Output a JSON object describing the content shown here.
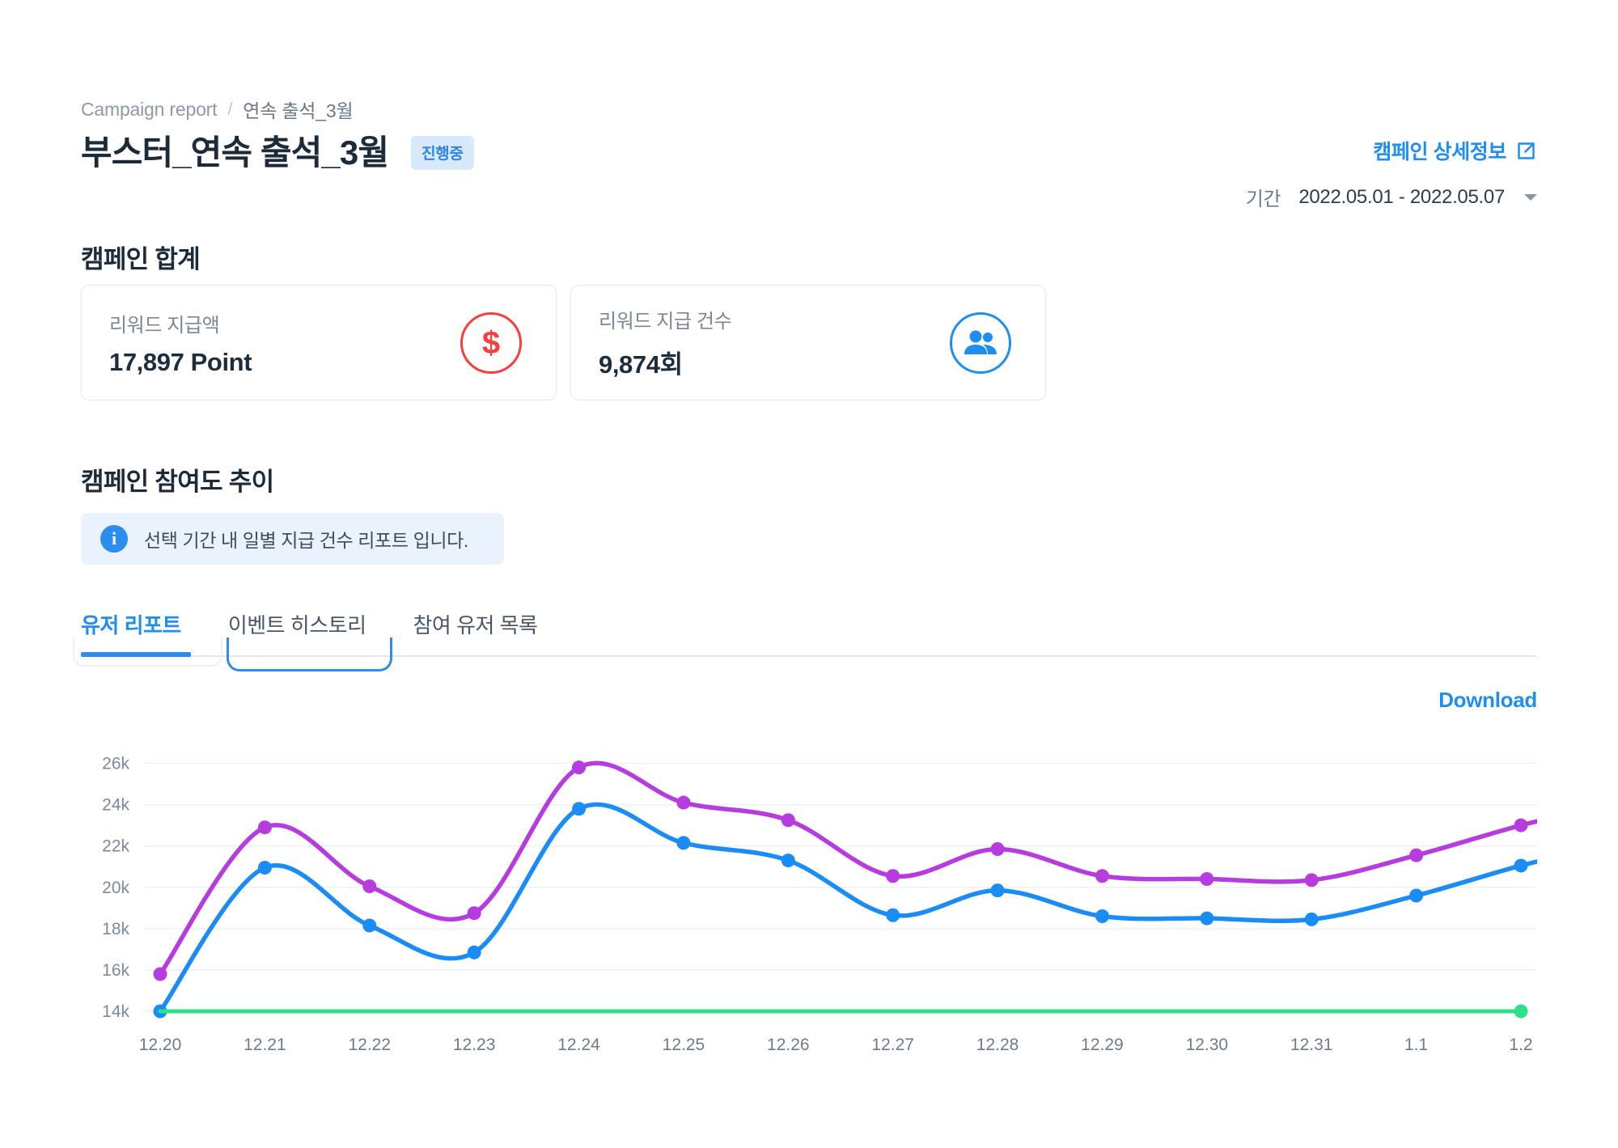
{
  "breadcrumb": {
    "root": "Campaign report",
    "separator": "/",
    "current": "연속 출석_3월"
  },
  "header": {
    "title": "부스터_연속 출석_3월",
    "status_badge": "진행중",
    "detail_link": "캠페인 상세정보",
    "detail_icon": "external-link-icon",
    "period_label": "기간",
    "period_value": "2022.05.01 - 2022.05.07",
    "period_caret": "chevron-down-icon"
  },
  "summary": {
    "title": "캠페인 합계",
    "cards": [
      {
        "label": "리워드 지급액",
        "value": "17,897 Point",
        "icon": "dollar-circle-icon",
        "icon_glyph": "$",
        "color": "#fa3e3e"
      },
      {
        "label": "리워드 지급 건수",
        "value": "9,874회",
        "icon": "users-circle-icon",
        "color": "#1f8ef1"
      }
    ]
  },
  "trend": {
    "title": "캠페인 참여도 추이",
    "info_icon": "info-icon",
    "info_glyph": "i",
    "info_text": "선택 기간 내 일별 지급 건수 리포트 입니다.",
    "tabs": [
      {
        "label": "유저 리포트",
        "active": true
      },
      {
        "label": "이벤트 히스토리",
        "active": false
      },
      {
        "label": "참여 유저 목록",
        "active": false
      }
    ],
    "download_label": "Download"
  },
  "chart_data": {
    "type": "line",
    "title": "",
    "xlabel": "",
    "ylabel": "",
    "grid": true,
    "legend": "none",
    "ylim": [
      14000,
      27000
    ],
    "yticks": [
      14000,
      16000,
      18000,
      20000,
      22000,
      24000,
      26000
    ],
    "ytick_labels": [
      "14k",
      "16k",
      "18k",
      "20k",
      "22k",
      "24k",
      "26k"
    ],
    "categories": [
      "12.20",
      "12.21",
      "12.22",
      "12.23",
      "12.24",
      "12.25",
      "12.26",
      "12.27",
      "12.28",
      "12.29",
      "12.30",
      "12.31",
      "1.1",
      "1.2"
    ],
    "series": [
      {
        "name": "purple-series",
        "color": "#b63ce0",
        "values": [
          15800,
          22900,
          20050,
          18750,
          25800,
          24100,
          23250,
          20550,
          21850,
          20550,
          20400,
          20350,
          21550,
          23000
        ]
      },
      {
        "name": "blue-series",
        "color": "#1a8cf5",
        "values": [
          14000,
          20950,
          18150,
          16850,
          23800,
          22150,
          21300,
          18650,
          19850,
          18600,
          18500,
          18450,
          19600,
          21050
        ]
      },
      {
        "name": "green-baseline",
        "color": "#2ee08a",
        "values": [
          14000,
          14000,
          14000,
          14000,
          14000,
          14000,
          14000,
          14000,
          14000,
          14000,
          14000,
          14000,
          14000,
          14000
        ],
        "markers": "endpoints-only"
      }
    ]
  }
}
